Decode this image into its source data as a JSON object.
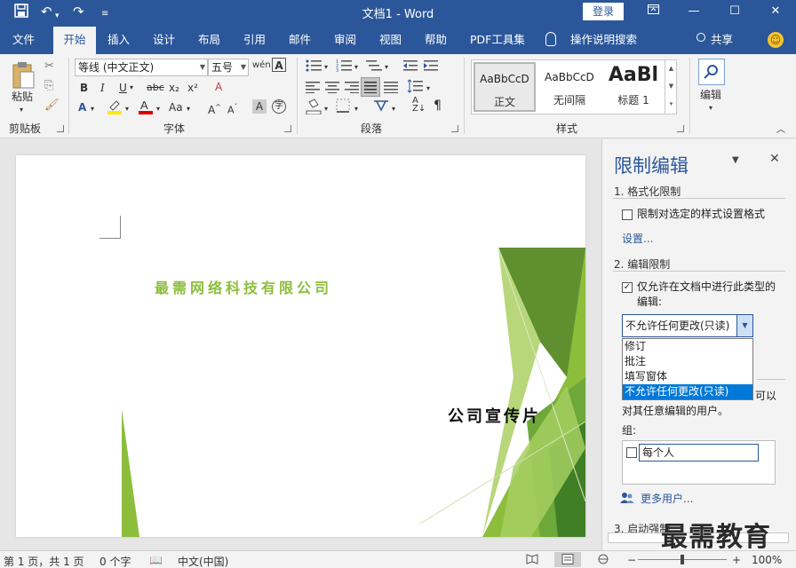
{
  "titlebar": {
    "title": "文档1 - Word",
    "login": "登录",
    "quick_access": [
      "save-icon",
      "undo-icon",
      "redo-icon",
      "customize-icon"
    ]
  },
  "tabs": [
    {
      "label": "文件"
    },
    {
      "label": "开始"
    },
    {
      "label": "插入"
    },
    {
      "label": "设计"
    },
    {
      "label": "布局"
    },
    {
      "label": "引用"
    },
    {
      "label": "邮件"
    },
    {
      "label": "审阅"
    },
    {
      "label": "视图"
    },
    {
      "label": "帮助"
    },
    {
      "label": "PDF工具集"
    },
    {
      "label": "操作说明搜索"
    }
  ],
  "share_label": "共享",
  "ribbon": {
    "clipboard": {
      "paste": "粘贴",
      "label": "剪贴板"
    },
    "font": {
      "name": "等线 (中文正文)",
      "size": "五号",
      "label": "字体"
    },
    "paragraph": {
      "label": "段落"
    },
    "styles": {
      "label": "样式",
      "items": [
        {
          "preview": "AaBbCcD",
          "name": "正文"
        },
        {
          "preview": "AaBbCcD",
          "name": "无间隔"
        },
        {
          "preview": "AaBl",
          "name": "标题 1"
        }
      ]
    },
    "editing": {
      "label": "编辑"
    }
  },
  "document": {
    "company": "最需网络科技有限公司",
    "promo": "公司宣传片",
    "accent_colors": [
      "#8cbe3c",
      "#5f8f2f",
      "#b7d77a",
      "#2e6e1f"
    ]
  },
  "pane": {
    "title": "限制编辑",
    "sec1": "1. 格式化限制",
    "sec1_check": "限制对选定的样式设置格式",
    "settings_link": "设置...",
    "sec2": "2. 编辑限制",
    "sec2_check_line1": "仅允许在文档中进行此类型的",
    "sec2_check_line2": "编辑:",
    "dropdown_value": "不允许任何更改(只读)",
    "dropdown_options": [
      "修订",
      "批注",
      "填写窗体",
      "不允许任何更改(只读)"
    ],
    "exceptions_tail": "可以",
    "exceptions_line2": "对其任意编辑的用户。",
    "group_label": "组:",
    "group_everyone": "每个人",
    "more_users": "更多用户...",
    "sec3": "3. 启动强制"
  },
  "watermark": "最需教育",
  "status": {
    "page": "第 1 页，共 1 页",
    "words": "0 个字",
    "lang": "中文(中国)",
    "zoom": "100%"
  }
}
